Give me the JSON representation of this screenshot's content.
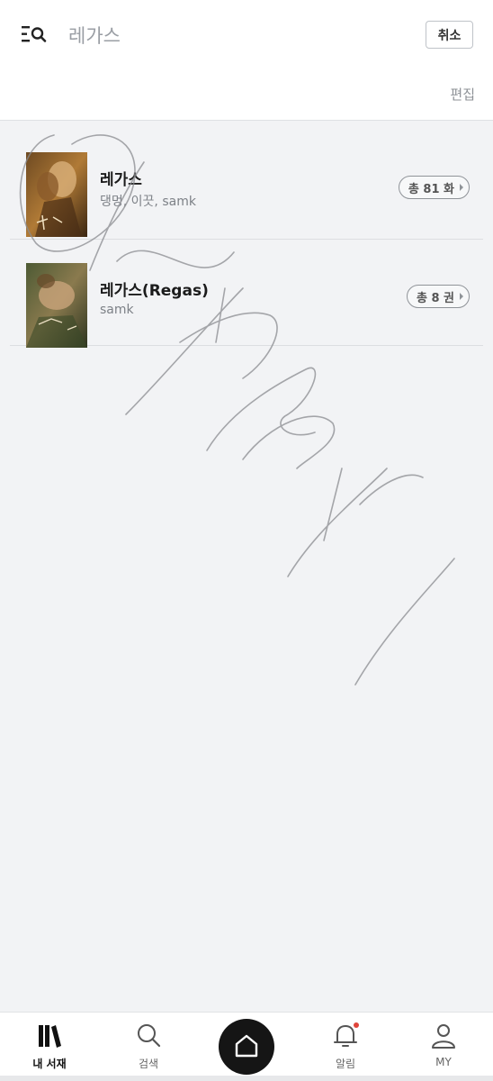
{
  "header": {
    "search_query": "레가스",
    "cancel_label": "취소",
    "edit_label": "편집"
  },
  "results": [
    {
      "title": "레가스",
      "authors": "댕멍, 이끗, samk",
      "count_label": "총 81 화"
    },
    {
      "title": "레가스(Regas)",
      "authors": "samk",
      "count_label": "총 8 권"
    }
  ],
  "nav": {
    "items": [
      {
        "label": "내 서재",
        "icon": "bookshelf-icon"
      },
      {
        "label": "검색",
        "icon": "search-icon"
      },
      {
        "label": "",
        "icon": "home-icon"
      },
      {
        "label": "알림",
        "icon": "bell-icon"
      },
      {
        "label": "MY",
        "icon": "person-icon"
      }
    ]
  },
  "colors": {
    "background": "#f2f3f5",
    "notification_dot": "#e0443a",
    "home_button": "#151515"
  }
}
